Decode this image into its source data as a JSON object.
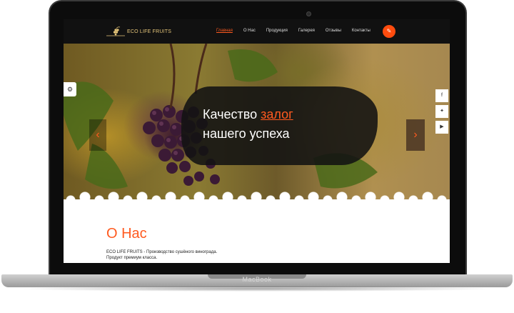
{
  "device": {
    "brand": "MacBook"
  },
  "site": {
    "logo_text": "ECO LIFE FRUITS",
    "nav": [
      "Главная",
      "О Нас",
      "Продукция",
      "Галерея",
      "Отзывы",
      "Контакты"
    ],
    "hero": {
      "line1_prefix": "Качество ",
      "line1_accent": "залог",
      "line2": "нашего успеха"
    },
    "about": {
      "title": "О Нас",
      "text_line1": "ECO LIFE FRUITS - Производство сушёного винограда.",
      "text_line2": "Продукт премиум класса."
    },
    "icons": {
      "settings": "gears-icon",
      "facebook": "facebook-icon",
      "twitter": "twitter-icon",
      "youtube": "youtube-icon",
      "edit": "edit-icon",
      "prev": "chevron-left-icon",
      "next": "chevron-right-icon"
    },
    "colors": {
      "accent": "#ff5a1f",
      "topbar": "#111111",
      "logo": "#e6c67a"
    }
  }
}
